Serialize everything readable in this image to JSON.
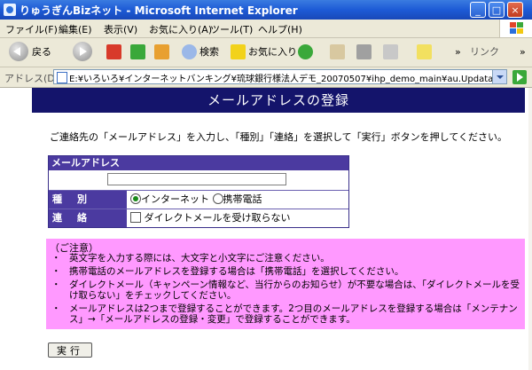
{
  "window": {
    "title": "りゅうぎんBizネット - Microsoft Internet Explorer"
  },
  "menu": [
    "ファイル(F)",
    "編集(E)",
    "表示(V)",
    "お気に入り(A)",
    "ツール(T)",
    "ヘルプ(H)"
  ],
  "toolbar": {
    "back": "戻る",
    "search": "検索",
    "favorites": "お気に入り",
    "links": "リンク",
    "more1": "»",
    "more2": "»"
  },
  "address": {
    "label": "アドレス(D)",
    "url": "E:¥いろいろ¥インターネットバンキング¥琉球銀行様法人デモ_20070507¥ihp_demo_main¥au.UpdataAply.html"
  },
  "page": {
    "banner": "メールアドレスの登録",
    "intro": "ご連絡先の「メールアドレス」を入力し、「種別」「連絡」を選択して「実行」ボタンを押してください。",
    "form": {
      "email_header": "メールアドレス",
      "email_value": "",
      "type_label": "種　別",
      "type_options": [
        "インターネット",
        "携帯電話"
      ],
      "type_selected": "インターネット",
      "contact_label": "連　絡",
      "contact_option": "ダイレクトメールを受け取らない"
    },
    "notice": {
      "heading": "（ご注意）",
      "items": [
        "英文字を入力する際には、大文字と小文字にご注意ください。",
        "携帯電話のメールアドレスを登録する場合は「携帯電話」を選択してください。",
        "ダイレクトメール（キャンペーン情報など、当行からのお知らせ）が不要な場合は、「ダイレクトメールを受け取らない」をチェックしてください。",
        "メールアドレスは2つまで登録することができます。2つ目のメールアドレスを登録する場合は「メンテナンス」→「メールアドレスの登録・変更」で登録することができます。"
      ]
    },
    "submit_label": "実行"
  }
}
